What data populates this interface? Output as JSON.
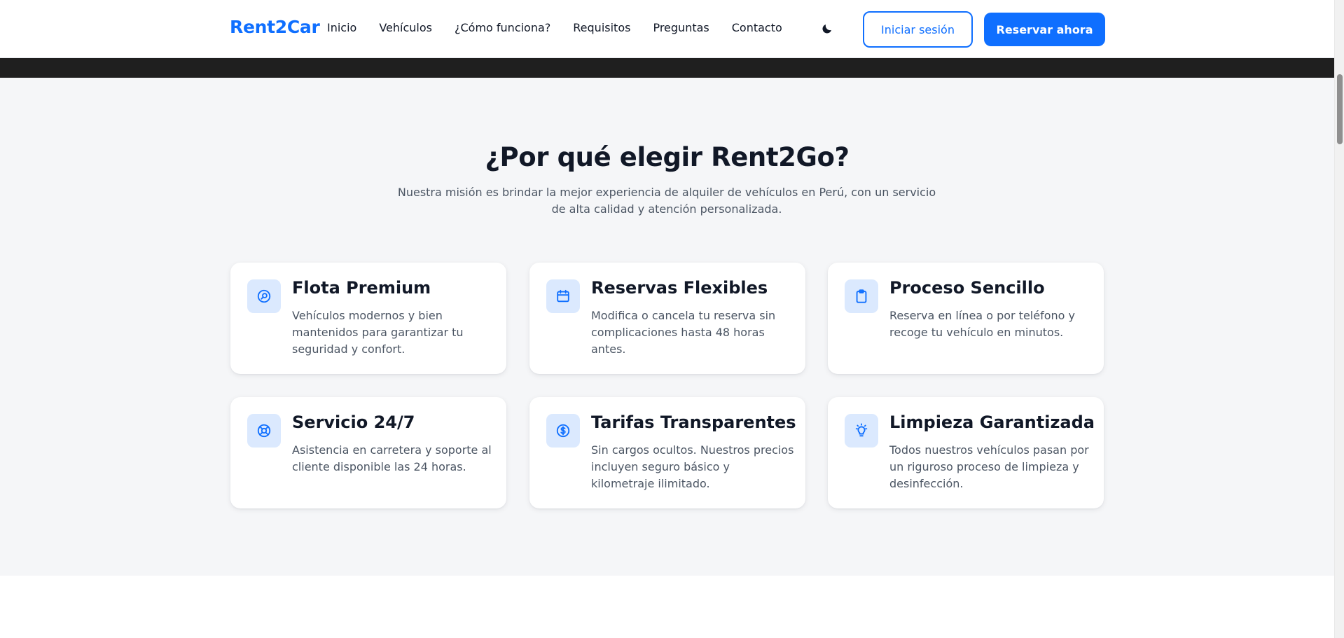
{
  "navbar": {
    "brand": "Rent2Car",
    "links": [
      "Inicio",
      "Vehículos",
      "¿Cómo funciona?",
      "Requisitos",
      "Preguntas",
      "Contacto"
    ],
    "theme_icon": "moon-icon",
    "login_label": "Iniciar sesión",
    "reserve_label": "Reservar ahora"
  },
  "features": {
    "title": "¿Por qué elegir Rent2Go?",
    "subtitle": "Nuestra misión es brindar la mejor experiencia de alquiler de vehículos en Perú, con un servicio de alta calidad y atención personalizada.",
    "cards": [
      {
        "icon": "search-icon",
        "title": "Flota Premium",
        "description": "Vehículos modernos y bien mantenidos para garantizar tu seguridad y confort."
      },
      {
        "icon": "calendar-icon",
        "title": "Reservas Flexibles",
        "description": "Modifica o cancela tu reserva sin complicaciones hasta 48 horas antes."
      },
      {
        "icon": "clipboard-icon",
        "title": "Proceso Sencillo",
        "description": "Reserva en línea o por teléfono y recoge tu vehículo en minutos."
      },
      {
        "icon": "lifebuoy-icon",
        "title": "Servicio 24/7",
        "description": "Asistencia en carretera y soporte al cliente disponible las 24 horas."
      },
      {
        "icon": "dollar-icon",
        "title": "Tarifas Transparentes",
        "description": "Sin cargos ocultos. Nuestros precios incluyen seguro básico y kilometraje ilimitado."
      },
      {
        "icon": "lightbulb-icon",
        "title": "Limpieza Garantizada",
        "description": "Todos nuestros vehículos pasan por un riguroso proceso de limpieza y desinfección."
      }
    ]
  },
  "colors": {
    "accent": "#0f6fff",
    "icon_bg": "#dbe9fe",
    "section_bg": "#f5f6f8",
    "hero_strip": "#1f1f1f"
  }
}
